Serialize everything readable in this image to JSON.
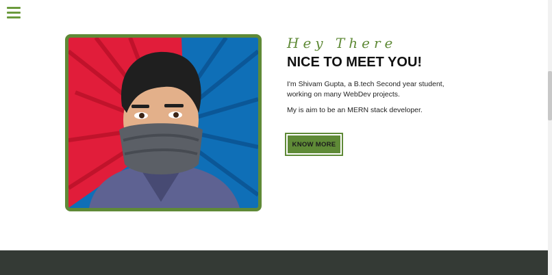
{
  "nav": {
    "menu_icon": "hamburger-menu-icon"
  },
  "hero": {
    "greeting": "Hey There",
    "title": "NICE TO MEET YOU!",
    "paragraph1": "I'm Shivam Gupta, a B.tech Second year student, working on many WebDev projects.",
    "paragraph2": "My is aim to be an MERN stack developer.",
    "cta_label": "KNOW MORE",
    "portrait_alt": "cartoon portrait with face mask"
  },
  "colors": {
    "accent": "#5f8a37",
    "footer": "#343a35",
    "portrait_red": "#e11d3a",
    "portrait_blue": "#0f6fb7"
  }
}
